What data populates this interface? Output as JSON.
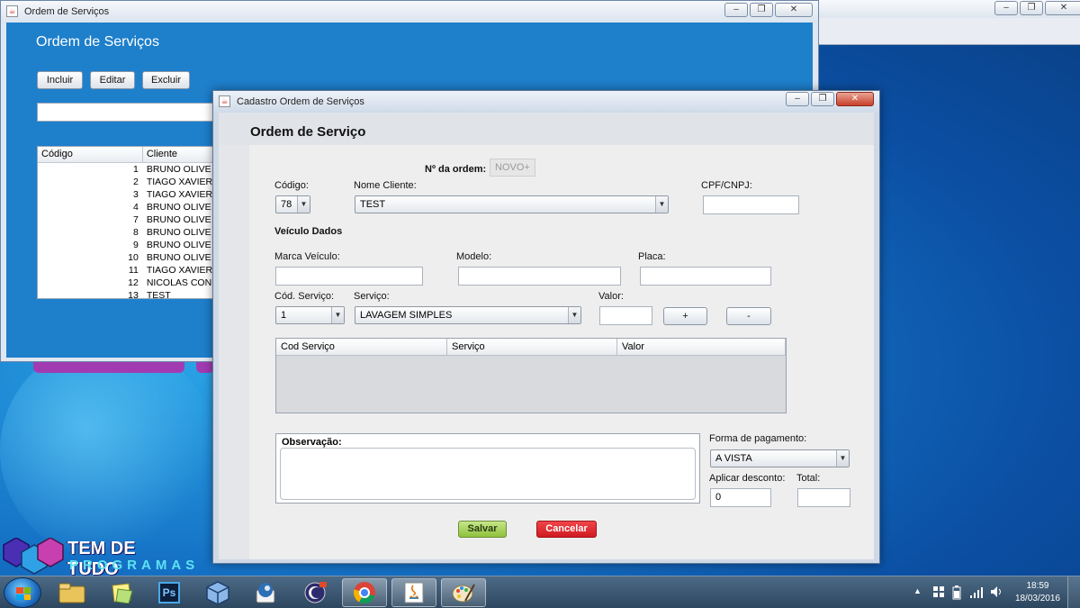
{
  "main_window": {
    "title": "Ordem de Serviços",
    "heading": "Ordem de Serviços",
    "buttons": {
      "incluir": "Incluir",
      "editar": "Editar",
      "excluir": "Excluir"
    },
    "table": {
      "headers": [
        "Código",
        "Cliente"
      ],
      "rows": [
        [
          "1",
          "BRUNO OLIVE"
        ],
        [
          "2",
          "TIAGO XAVIER"
        ],
        [
          "3",
          "TIAGO XAVIER"
        ],
        [
          "4",
          "BRUNO OLIVE"
        ],
        [
          "7",
          "BRUNO OLIVE"
        ],
        [
          "8",
          "BRUNO OLIVE"
        ],
        [
          "9",
          "BRUNO OLIVE"
        ],
        [
          "10",
          "BRUNO OLIVE"
        ],
        [
          "11",
          "TIAGO XAVIER"
        ],
        [
          "12",
          "NICOLAS CON"
        ],
        [
          "13",
          "TEST"
        ]
      ]
    }
  },
  "dialog": {
    "title": "Cadastro Ordem de Serviços",
    "heading": "Ordem de Serviço",
    "order_number_label": "Nº da ordem:",
    "order_number_value": "NOVO+",
    "codigo_label": "Código:",
    "codigo_value": "78",
    "nome_cliente_label": "Nome Cliente:",
    "nome_cliente_value": "TEST",
    "cpf_label": "CPF/CNPJ:",
    "cpf_value": "",
    "veiculo_section": "Veículo Dados",
    "marca_label": "Marca Veículo:",
    "marca_value": "",
    "modelo_label": "Modelo:",
    "modelo_value": "",
    "placa_label": "Placa:",
    "placa_value": "",
    "cod_servico_label": "Cód. Serviço:",
    "cod_servico_value": "1",
    "servico_label": "Serviço:",
    "servico_value": "LAVAGEM SIMPLES",
    "valor_label": "Valor:",
    "valor_value": "",
    "add_label": "+",
    "remove_label": "-",
    "items_table_headers": [
      "Cod Serviço",
      "Serviço",
      "Valor"
    ],
    "observacao_label": "Observação:",
    "observacao_value": "",
    "forma_pagamento_label": "Forma de pagamento:",
    "forma_pagamento_value": "A VISTA",
    "desconto_label": "Aplicar desconto:",
    "desconto_value": "0",
    "total_label": "Total:",
    "total_value": "",
    "save_label": "Salvar",
    "cancel_label": "Cancelar"
  },
  "logo": {
    "line1": "TEM DE TUDO",
    "line2": "PROGRAMAS"
  },
  "taskbar": {
    "items": [
      "start-button",
      "file-explorer-icon",
      "notes-icon",
      "photoshop-icon",
      "virtualbox-icon",
      "thunderbird-icon",
      "eclipse-icon",
      "chrome-icon",
      "java-icon",
      "paint-icon"
    ],
    "photoshop_text": "Ps",
    "clock_time": "18:59",
    "clock_date": "18/03/2016"
  },
  "colors": {
    "desktop": "#1470c4",
    "main_window_body": "#1e7fcb",
    "save_button": "#8fc13d",
    "cancel_button": "#cf1a20",
    "purple_bar": "#a23bb2"
  }
}
